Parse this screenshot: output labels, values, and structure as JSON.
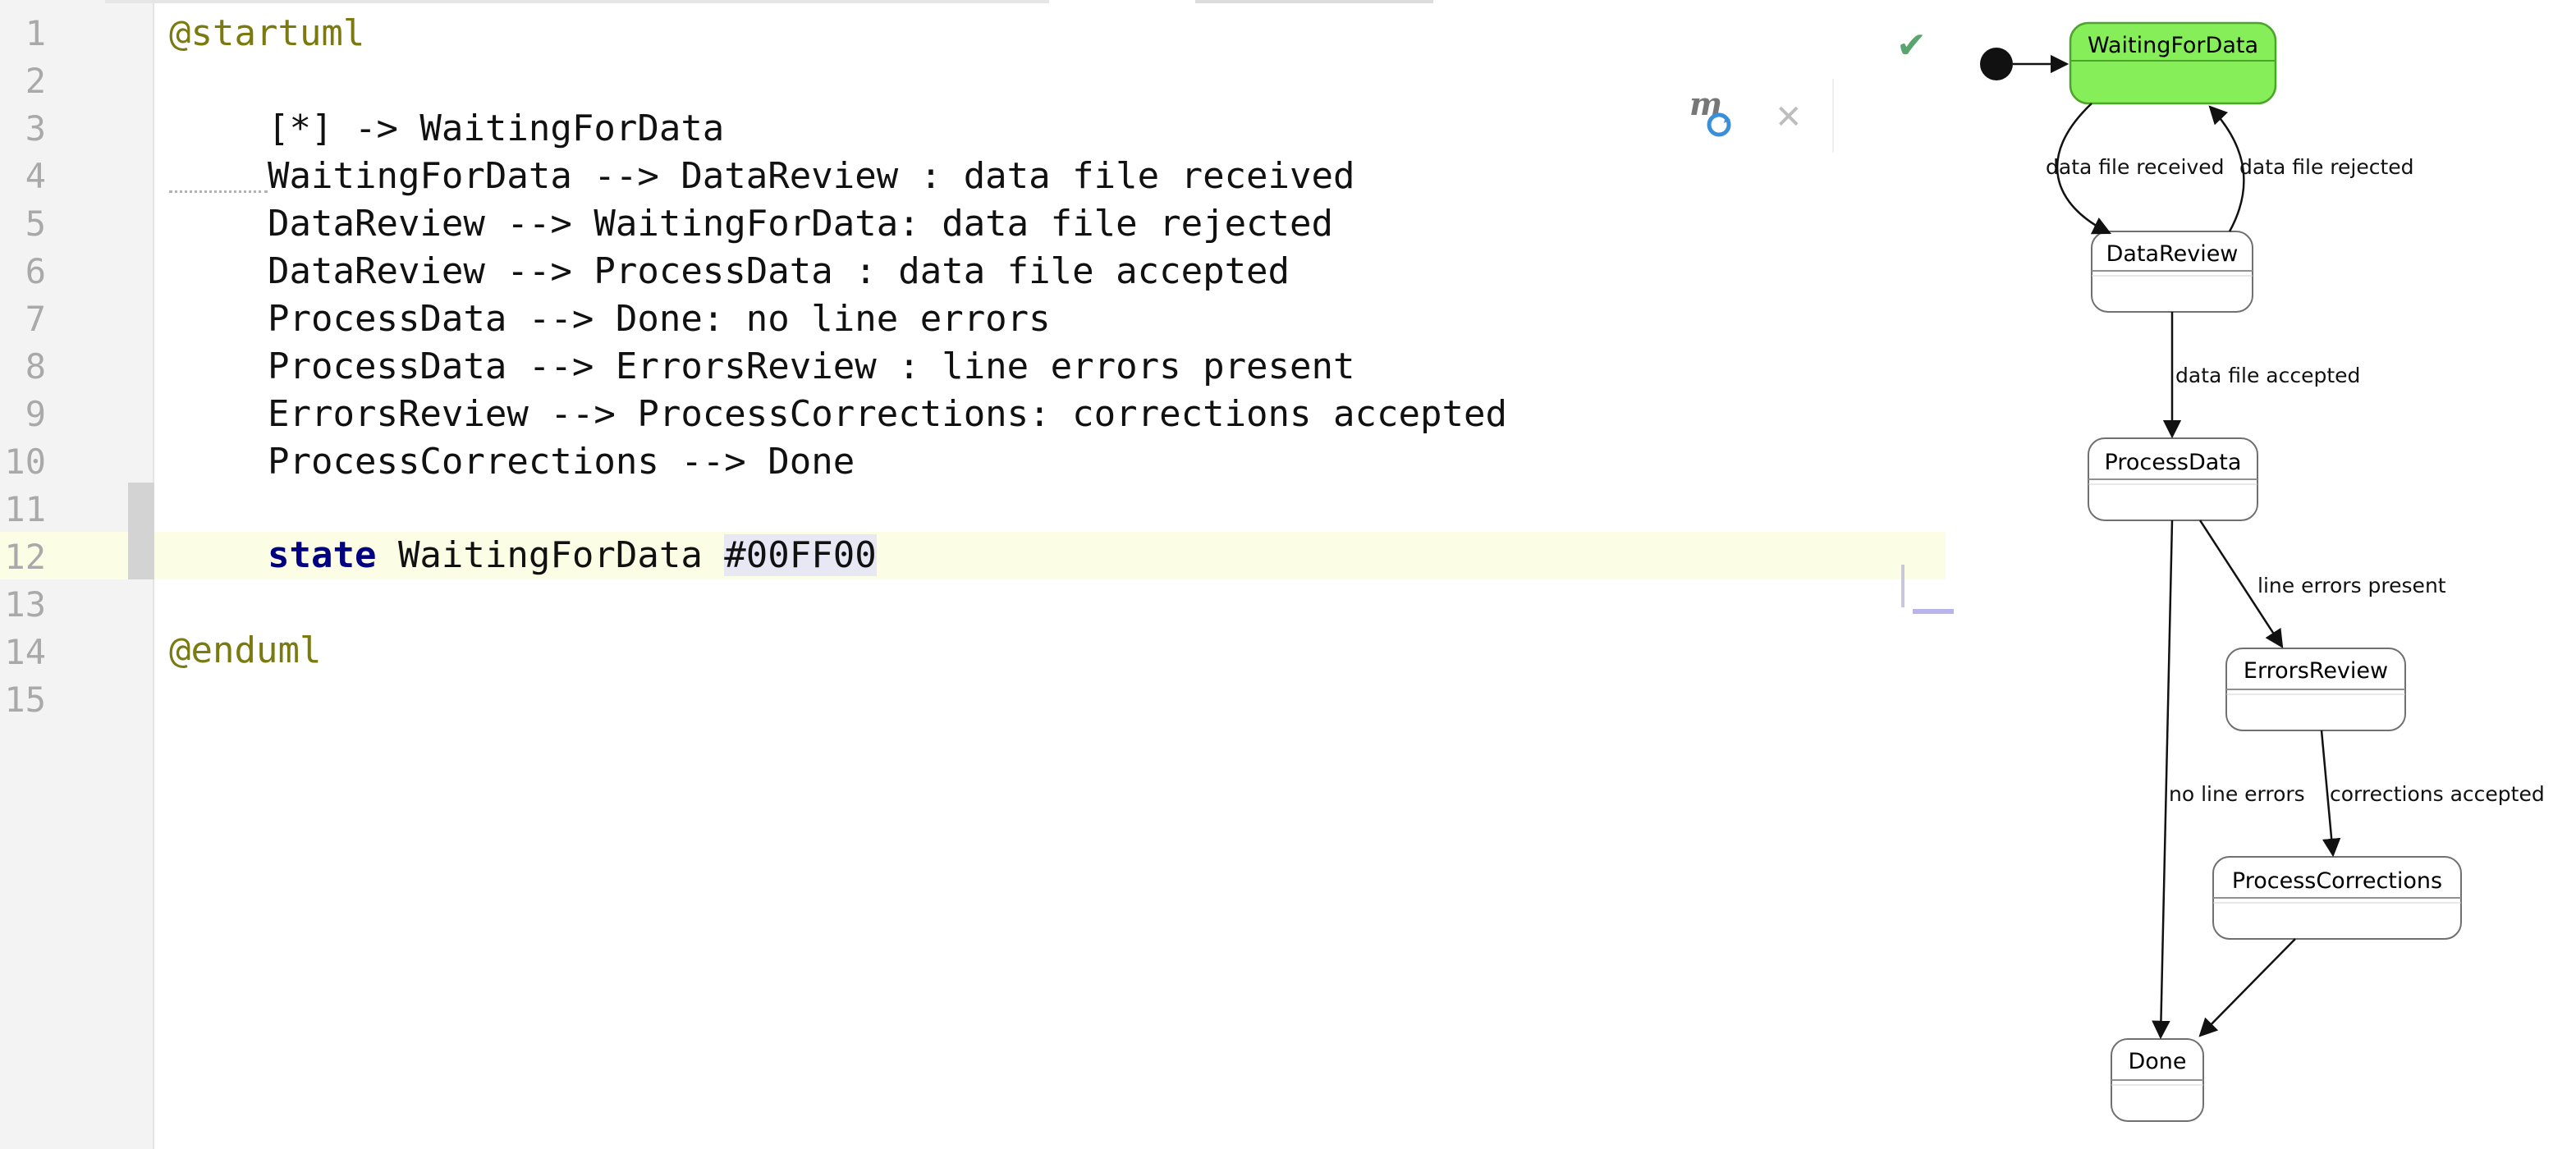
{
  "editor": {
    "line_numbers": [
      "1",
      "2",
      "3",
      "4",
      "5",
      "6",
      "7",
      "8",
      "9",
      "10",
      "11",
      "12",
      "13",
      "14",
      "15"
    ],
    "lines": {
      "l1": "@startuml",
      "l3": "[*] -> WaitingForData",
      "l4": "WaitingForData --> DataReview : data file received",
      "l5": "DataReview --> WaitingForData: data file rejected",
      "l6": "DataReview --> ProcessData : data file accepted",
      "l7": "ProcessData --> Done: no line errors",
      "l8": "ProcessData --> ErrorsReview : line errors present",
      "l9": "ErrorsReview --> ProcessCorrections: corrections accepted",
      "l10": "ProcessCorrections --> Done",
      "l12_keyword": "state",
      "l12_name": " WaitingForData ",
      "l12_color": "#00FF00",
      "l14": "@enduml"
    },
    "indent": "    "
  },
  "toolbar": {
    "maven_icon": "m-refresh-icon",
    "close_icon": "close-icon",
    "status_icon": "check-icon"
  },
  "diagram": {
    "states": {
      "waiting": "WaitingForData",
      "review": "DataReview",
      "process": "ProcessData",
      "errors": "ErrorsReview",
      "corrections": "ProcessCorrections",
      "done": "Done"
    },
    "transitions": {
      "received": "data file received",
      "rejected": "data file rejected",
      "accepted": "data file accepted",
      "line_errors": "line errors present",
      "no_errors": "no line errors",
      "corrections": "corrections accepted"
    },
    "colors": {
      "highlight_state": "#86ee58",
      "state_fill": "#ffffff",
      "state_border": "#707070"
    }
  }
}
